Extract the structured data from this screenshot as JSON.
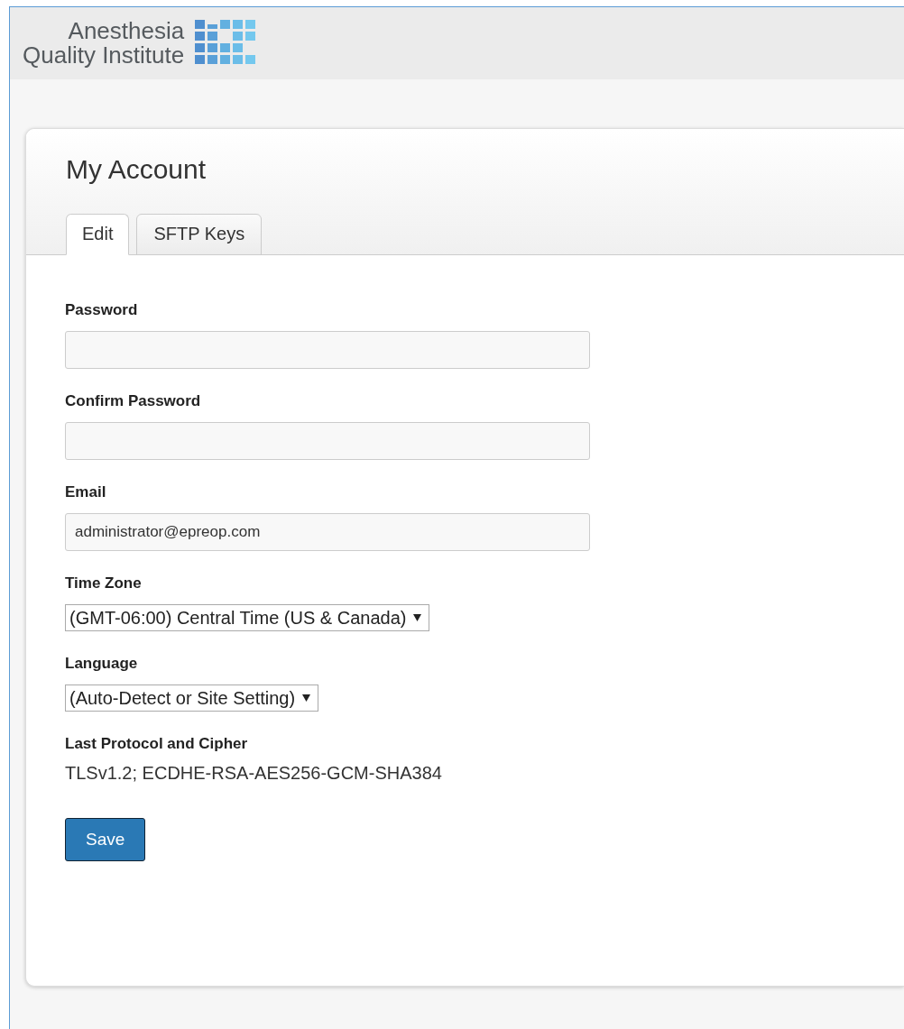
{
  "header": {
    "logo_lines": [
      "Anesthesia",
      "Quality Institute"
    ]
  },
  "page": {
    "title": "My Account",
    "tabs": [
      {
        "label": "Edit",
        "selected": true
      },
      {
        "label": "SFTP Keys",
        "selected": false
      }
    ],
    "fields": [
      {
        "kind": "input",
        "label": "Password"
      },
      {
        "kind": "input",
        "label": "Confirm Password"
      },
      {
        "kind": "input",
        "label": "Email",
        "value": "administrator@epreop.com"
      },
      {
        "kind": "select",
        "label": "Time Zone",
        "value": "(GMT-06:00) Central Time (US & Canada)"
      },
      {
        "kind": "select",
        "label": "Language",
        "value": "(Auto-Detect or Site Setting)"
      },
      {
        "kind": "text",
        "label": "Last Protocol and Cipher",
        "value": "TLSv1.2; ECDHE-RSA-AES256-GCM-SHA384"
      }
    ],
    "save_button": "Save"
  }
}
